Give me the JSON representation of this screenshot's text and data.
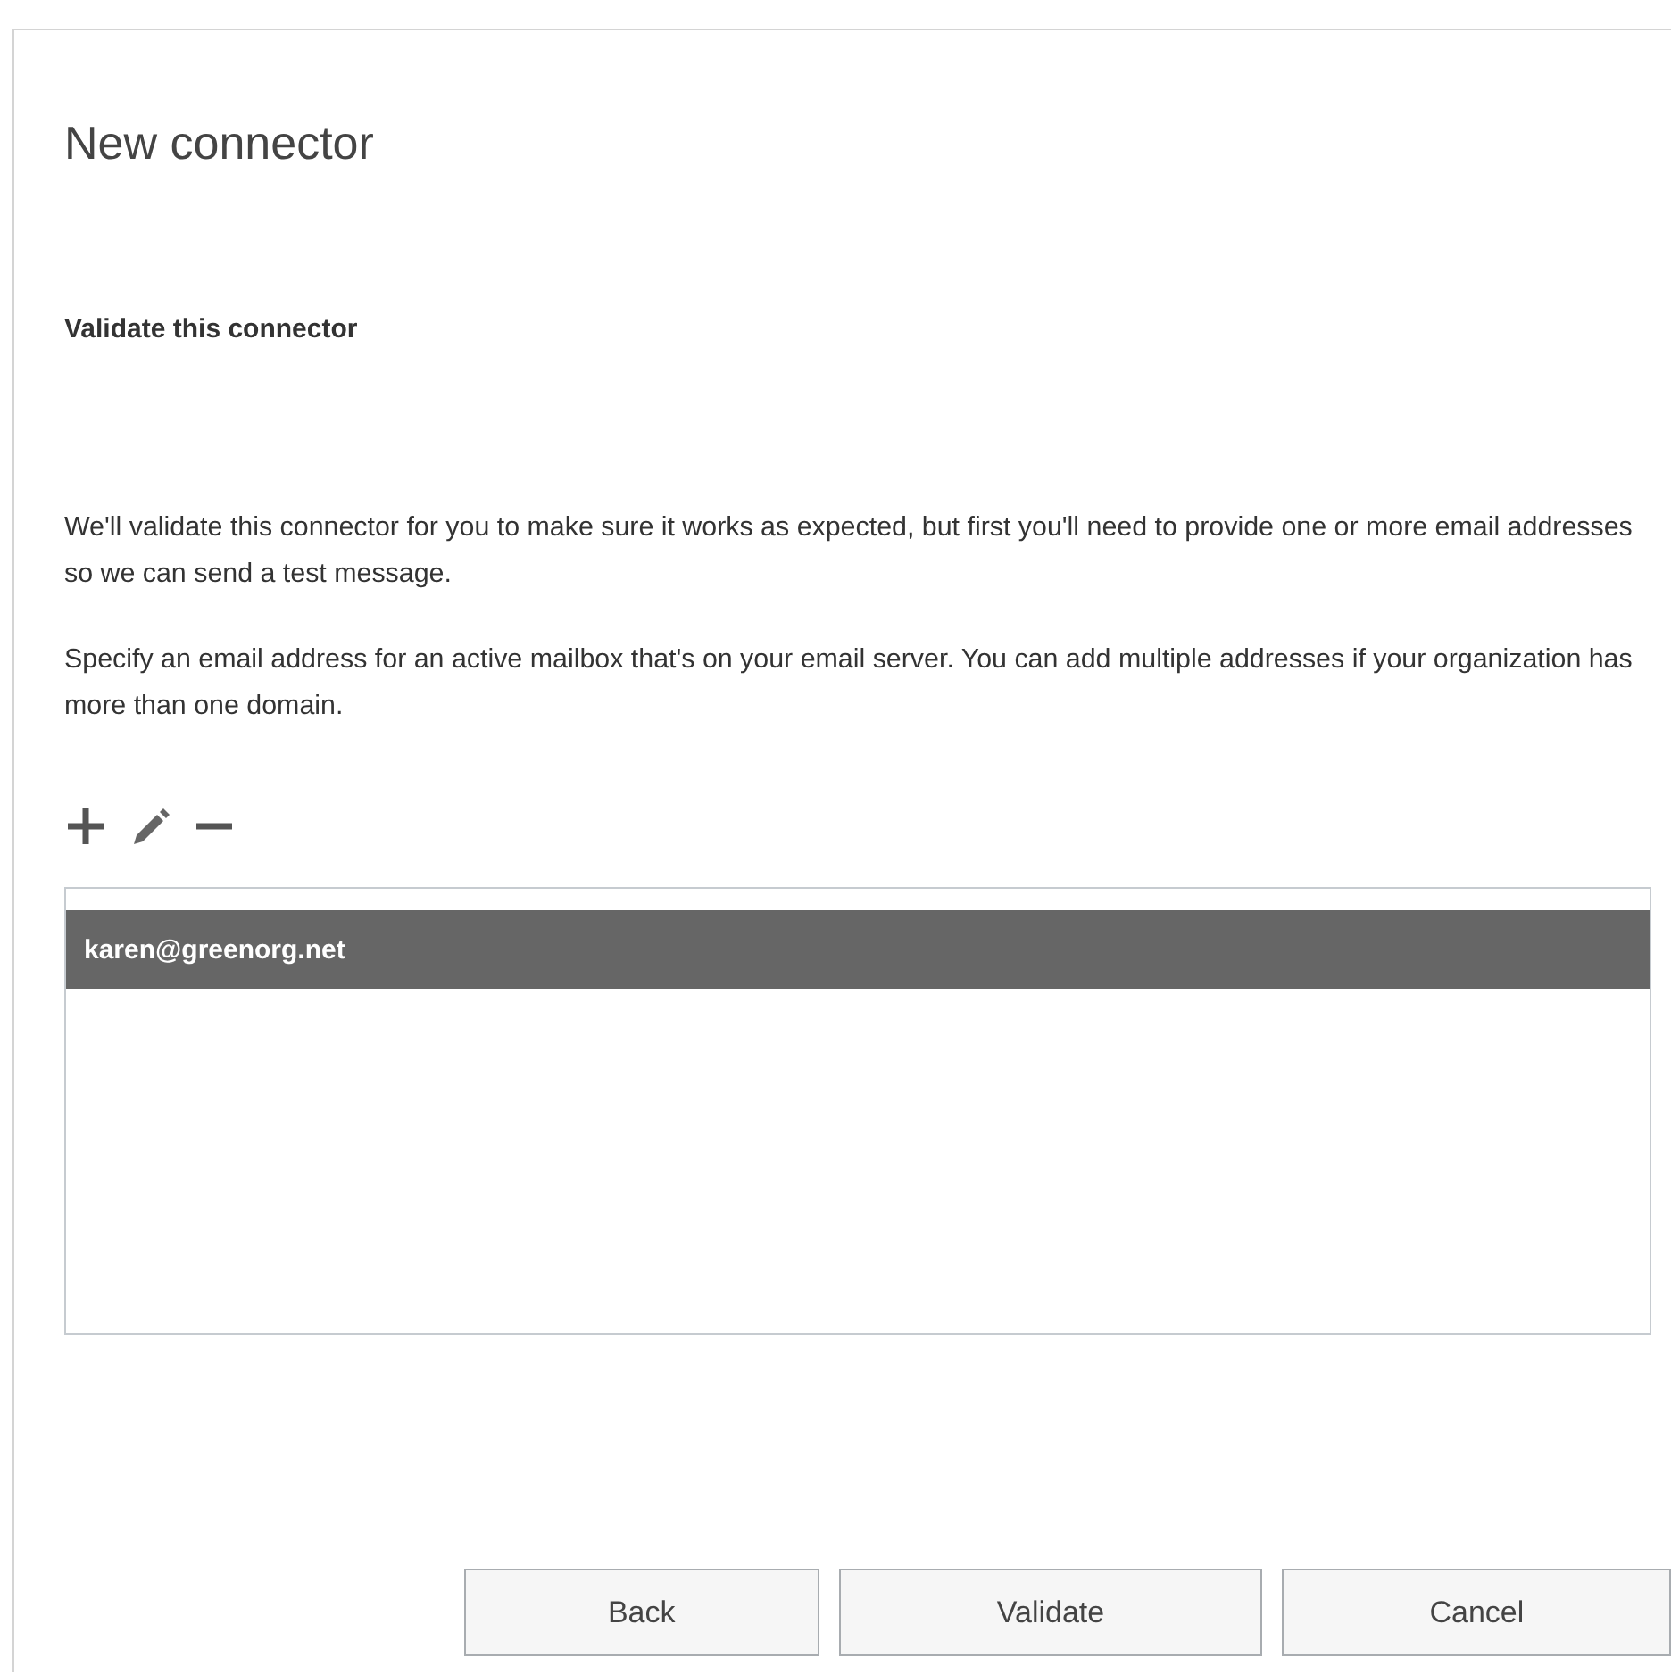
{
  "dialog": {
    "title": "New connector",
    "heading": "Validate this connector",
    "paragraphs": [
      "We'll validate this connector for you to make sure it works as expected, but first you'll need to provide one or more email addresses so we can send a test message.",
      "Specify an email address for an active mailbox that's on your email server. You can add multiple addresses if your organization has more than one domain."
    ],
    "toolbar": [
      {
        "kind": "add"
      },
      {
        "kind": "edit"
      },
      {
        "kind": "remove"
      }
    ],
    "addresses": [
      {
        "text": "karen@greenorg.net",
        "selected": true
      }
    ],
    "buttons": [
      "Back",
      "Validate",
      "Cancel"
    ]
  }
}
